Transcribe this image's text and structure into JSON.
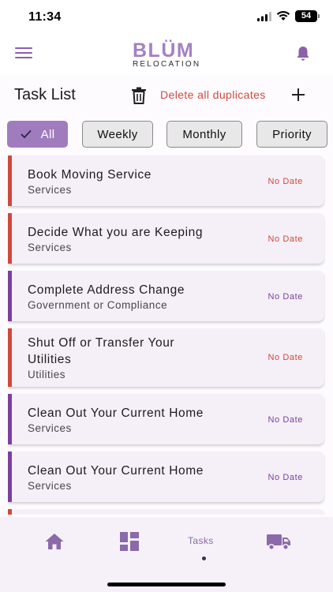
{
  "status": {
    "time": "11:34",
    "battery": "54"
  },
  "header": {
    "logo_main": "BLÜM",
    "logo_sub": "RELOCATION"
  },
  "title_row": {
    "title": "Task List",
    "delete_duplicates": "Delete all duplicates"
  },
  "filters": [
    {
      "label": "All",
      "active": true
    },
    {
      "label": "Weekly",
      "active": false
    },
    {
      "label": "Monthly",
      "active": false
    },
    {
      "label": "Priority",
      "active": false
    }
  ],
  "tasks": [
    {
      "title": "Book Moving Service",
      "category": "Services",
      "date": "No Date",
      "accent": "#d0493c"
    },
    {
      "title": "Decide What you are Keeping",
      "category": "Services",
      "date": "No Date",
      "accent": "#d0493c"
    },
    {
      "title": "Complete Address Change",
      "category": "Government or Compliance",
      "date": "No Date",
      "accent": "#7b3fa0"
    },
    {
      "title": "Shut Off or Transfer Your Utilities",
      "category": "Utilities",
      "date": "No Date",
      "accent": "#d0493c"
    },
    {
      "title": "Clean Out Your Current Home",
      "category": "Services",
      "date": "No Date",
      "accent": "#7b3fa0"
    },
    {
      "title": "Clean Out Your Current Home",
      "category": "Services",
      "date": "No Date",
      "accent": "#7b3fa0"
    }
  ],
  "nav": {
    "tasks_label": "Tasks"
  },
  "colors": {
    "brand": "#a07cbe",
    "danger": "#d0493c",
    "purple": "#7b3fa0"
  }
}
